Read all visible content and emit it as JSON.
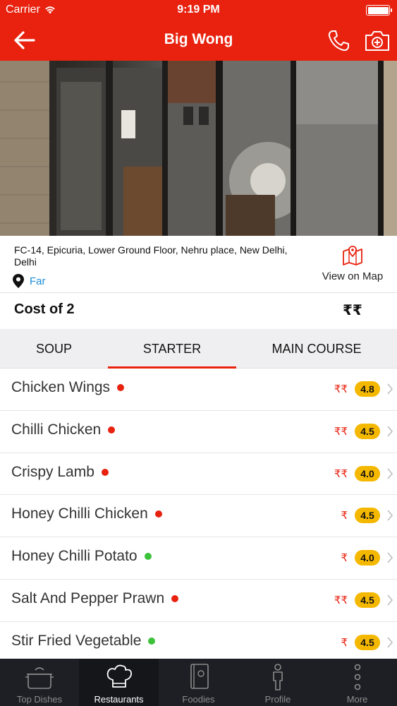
{
  "status_bar": {
    "carrier": "Carrier",
    "time": "9:19 PM"
  },
  "header": {
    "title": "Big Wong"
  },
  "restaurant": {
    "address": "FC-14, Epicuria, Lower Ground Floor, Nehru place, New Delhi, Delhi",
    "distance": "Far",
    "map_label": "View on Map",
    "cost_label": "Cost of 2",
    "cost_value": "₹₹"
  },
  "tabs": [
    {
      "label": "SOUP",
      "active": false
    },
    {
      "label": "STARTER",
      "active": true
    },
    {
      "label": "MAIN COURSE",
      "active": false
    }
  ],
  "dishes": [
    {
      "name": "Chicken Wings",
      "type": "non-veg",
      "price": "₹₹",
      "rating": "4.8"
    },
    {
      "name": "Chilli Chicken",
      "type": "non-veg",
      "price": "₹₹",
      "rating": "4.5"
    },
    {
      "name": "Crispy Lamb",
      "type": "non-veg",
      "price": "₹₹",
      "rating": "4.0"
    },
    {
      "name": "Honey Chilli Chicken",
      "type": "non-veg",
      "price": "₹",
      "rating": "4.5"
    },
    {
      "name": "Honey Chilli Potato",
      "type": "veg",
      "price": "₹",
      "rating": "4.0"
    },
    {
      "name": "Salt And Pepper Prawn",
      "type": "non-veg",
      "price": "₹₹",
      "rating": "4.5"
    },
    {
      "name": "Stir Fried Vegetable",
      "type": "veg",
      "price": "₹",
      "rating": "4.5"
    }
  ],
  "colors": {
    "brand": "#e8220f",
    "non_veg_dot": "#e8220f",
    "veg_dot": "#3cc23c",
    "rating_badge": "#f5b800",
    "link": "#1a8fd8",
    "tabbar_bg": "#1d1f24"
  },
  "tab_bar": [
    {
      "label": "Top Dishes",
      "icon": "cooking-pot-icon",
      "active": false
    },
    {
      "label": "Restaurants",
      "icon": "chef-hat-icon",
      "active": true
    },
    {
      "label": "Foodies",
      "icon": "book-icon",
      "active": false
    },
    {
      "label": "Profile",
      "icon": "person-icon",
      "active": false
    },
    {
      "label": "More",
      "icon": "more-dots-icon",
      "active": false
    }
  ]
}
